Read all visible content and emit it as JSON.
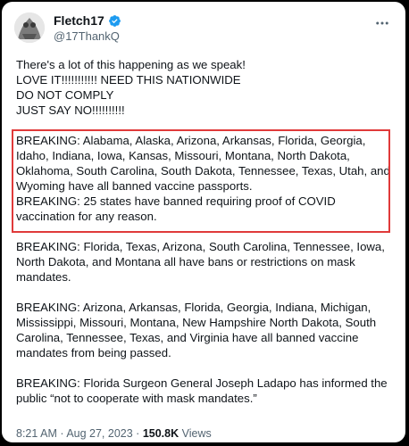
{
  "tweet": {
    "display_name": "Fletch17",
    "handle": "@17ThankQ",
    "more_icon": "more-horizontal-icon",
    "paragraphs": [
      "There's a lot of this happening as we speak!\nLOVE IT!!!!!!!!!!! NEED THIS NATIONWIDE\nDO NOT COMPLY\nJUST SAY NO!!!!!!!!!!",
      "BREAKING: Alabama, Alaska, Arizona, Arkansas, Florida, Georgia, Idaho, Indiana, Iowa, Kansas, Missouri, Montana, North Dakota, Oklahoma, South Carolina, South Dakota, Tennessee, Texas, Utah, and Wyoming have all banned vaccine passports.\nBREAKING: 25 states have banned requiring proof of COVID vaccination for any reason.",
      "BREAKING: Florida, Texas, Arizona, South Carolina, Tennessee, Iowa, North Dakota, and Montana all have bans or restrictions on mask mandates.",
      "BREAKING: Arizona, Arkansas, Florida, Georgia, Indiana, Michigan, Mississippi, Missouri, Montana, New Hampshire North Dakota, South Carolina, Tennessee, Texas, and Virginia have all banned vaccine mandates from being passed.",
      "BREAKING: Florida Surgeon General Joseph Ladapo has informed the public “not to cooperate with mask mandates.”"
    ],
    "time": "8:21 AM",
    "date": "Aug 27, 2023",
    "views_count": "150.8K",
    "views_label": "Views"
  },
  "colors": {
    "background": "#000000",
    "card": "#ffffff",
    "text": "#0f1419",
    "secondary_text": "#536471",
    "verified_badge": "#1d9bf0",
    "highlight_border": "#e03a3a"
  }
}
